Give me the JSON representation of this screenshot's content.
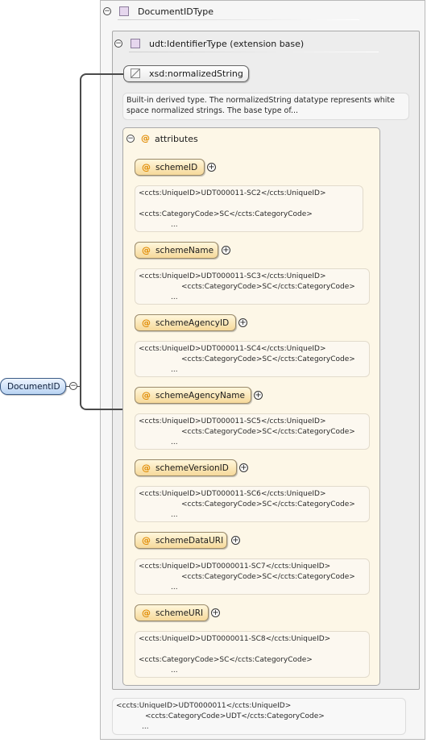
{
  "root_element": {
    "label": "DocumentID"
  },
  "complex_type": {
    "title": "DocumentIDType"
  },
  "base_type": {
    "title": "udt:IdentifierType (extension base)"
  },
  "simple_type": {
    "label": "xsd:normalizedString",
    "doc_line1": "Built-in derived type. The normalizedString datatype represents white",
    "doc_line2": "space normalized strings. The base type of..."
  },
  "attributes_group": {
    "label": "attributes"
  },
  "attributes": [
    {
      "name": "schemeID",
      "doc_line1": "<ccts:UniqueID>UDT000011-SC2</ccts:UniqueID>",
      "doc_line2": "<ccts:CategoryCode>SC</ccts:CategoryCode>",
      "doc_line3": "..."
    },
    {
      "name": "schemeName",
      "doc_line1": "<ccts:UniqueID>UDT000011-SC3</ccts:UniqueID>",
      "doc_line2": "<ccts:CategoryCode>SC</ccts:CategoryCode>",
      "doc_line3": "..."
    },
    {
      "name": "schemeAgencyID",
      "doc_line1": "<ccts:UniqueID>UDT000011-SC4</ccts:UniqueID>",
      "doc_line2": "<ccts:CategoryCode>SC</ccts:CategoryCode>",
      "doc_line3": "..."
    },
    {
      "name": "schemeAgencyName",
      "doc_line1": "<ccts:UniqueID>UDT000011-SC5</ccts:UniqueID>",
      "doc_line2": "<ccts:CategoryCode>SC</ccts:CategoryCode>",
      "doc_line3": "..."
    },
    {
      "name": "schemeVersionID",
      "doc_line1": "<ccts:UniqueID>UDT000011-SC6</ccts:UniqueID>",
      "doc_line2": "<ccts:CategoryCode>SC</ccts:CategoryCode>",
      "doc_line3": "..."
    },
    {
      "name": "schemeDataURI",
      "doc_line1": "<ccts:UniqueID>UDT0000011-SC7</ccts:UniqueID>",
      "doc_line2": "<ccts:CategoryCode>SC</ccts:CategoryCode>",
      "doc_line3": "..."
    },
    {
      "name": "schemeURI",
      "doc_line1": "<ccts:UniqueID>UDT0000011-SC8</ccts:UniqueID>",
      "doc_line2": "<ccts:CategoryCode>SC</ccts:CategoryCode>",
      "doc_line3": "..."
    }
  ],
  "type_doc": {
    "line1": "<ccts:UniqueID>UDT0000011</ccts:UniqueID>",
    "line2": "<ccts:CategoryCode>UDT</ccts:CategoryCode>",
    "line3": "..."
  },
  "icons": {
    "collapse": "minus-circle-icon",
    "expand": "plus-circle-icon",
    "type": "complex-type-icon",
    "simple": "simple-type-icon",
    "attribute": "attribute-at-icon"
  },
  "colors": {
    "element_border": "#3b5b86",
    "attribute_fill": "#f6d99a",
    "attribute_container": "#fdf7e7",
    "type_icon": "#e6d7ee"
  }
}
